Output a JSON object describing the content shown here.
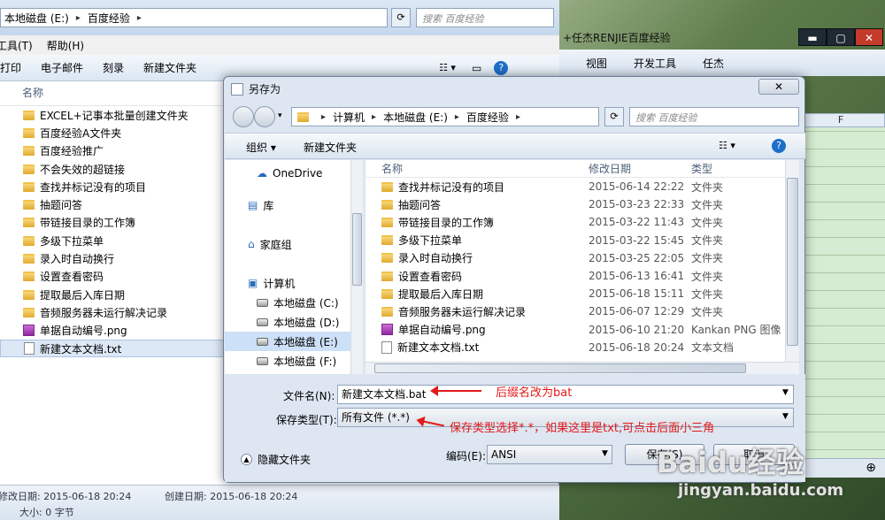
{
  "explorer": {
    "address": [
      "本地磁盘 (E:)",
      "百度经验"
    ],
    "search_placeholder": "搜索 百度经验",
    "menu": [
      "工具(T)",
      "帮助(H)"
    ],
    "toolbar": [
      "打印",
      "电子邮件",
      "刻录",
      "新建文件夹"
    ],
    "column_name": "名称",
    "items": [
      {
        "name": "EXCEL+记事本批量创建文件夹",
        "kind": "folder"
      },
      {
        "name": "百度经验A文件夹",
        "kind": "folder"
      },
      {
        "name": "百度经验推广",
        "kind": "folder"
      },
      {
        "name": "不会失效的超链接",
        "kind": "folder"
      },
      {
        "name": "查找并标记没有的项目",
        "kind": "folder"
      },
      {
        "name": "抽题问答",
        "kind": "folder"
      },
      {
        "name": "带链接目录的工作簿",
        "kind": "folder"
      },
      {
        "name": "多级下拉菜单",
        "kind": "folder"
      },
      {
        "name": "录入时自动换行",
        "kind": "folder"
      },
      {
        "name": "设置查看密码",
        "kind": "folder"
      },
      {
        "name": "提取最后入库日期",
        "kind": "folder"
      },
      {
        "name": "音频服务器未运行解决记录",
        "kind": "folder"
      },
      {
        "name": "单据自动编号.png",
        "kind": "png"
      },
      {
        "name": "新建文本文档.txt",
        "kind": "file",
        "selected": true
      }
    ],
    "status": {
      "modified_label": "修改日期:",
      "modified": "2015-06-18 20:24",
      "created_label": "创建日期:",
      "created": "2015-06-18 20:24",
      "size_label": "大小:",
      "size": "0 字节"
    }
  },
  "excel": {
    "title": "+任杰RENJIE百度经验",
    "ribbon": [
      "视图",
      "开发工具",
      "任杰"
    ],
    "column": "F"
  },
  "dialog": {
    "title": "另存为",
    "address": [
      "计算机",
      "本地磁盘 (E:)",
      "百度经验"
    ],
    "search_placeholder": "搜索 百度经验",
    "toolbar": {
      "organize": "组织 ▾",
      "new_folder": "新建文件夹"
    },
    "nav": [
      {
        "label": "OneDrive",
        "kind": "cloud"
      },
      {
        "label": "库",
        "kind": "lib"
      },
      {
        "label": "家庭组",
        "kind": "home"
      },
      {
        "label": "计算机",
        "kind": "pc"
      },
      {
        "label": "本地磁盘 (C:)",
        "kind": "drive"
      },
      {
        "label": "本地磁盘 (D:)",
        "kind": "drive"
      },
      {
        "label": "本地磁盘 (E:)",
        "kind": "drive",
        "selected": true
      },
      {
        "label": "本地磁盘 (F:)",
        "kind": "drive"
      }
    ],
    "columns": [
      "名称",
      "修改日期",
      "类型"
    ],
    "files": [
      {
        "name": "查找并标记没有的项目",
        "date": "2015-06-14 22:22",
        "type": "文件夹",
        "kind": "folder"
      },
      {
        "name": "抽题问答",
        "date": "2015-03-23 22:33",
        "type": "文件夹",
        "kind": "folder"
      },
      {
        "name": "带链接目录的工作簿",
        "date": "2015-03-22 11:43",
        "type": "文件夹",
        "kind": "folder"
      },
      {
        "name": "多级下拉菜单",
        "date": "2015-03-22 15:45",
        "type": "文件夹",
        "kind": "folder"
      },
      {
        "name": "录入时自动换行",
        "date": "2015-03-25 22:05",
        "type": "文件夹",
        "kind": "folder"
      },
      {
        "name": "设置查看密码",
        "date": "2015-06-13 16:41",
        "type": "文件夹",
        "kind": "folder"
      },
      {
        "name": "提取最后入库日期",
        "date": "2015-06-18 15:11",
        "type": "文件夹",
        "kind": "folder"
      },
      {
        "name": "音频服务器未运行解决记录",
        "date": "2015-06-07 12:29",
        "type": "文件夹",
        "kind": "folder"
      },
      {
        "name": "单据自动编号.png",
        "date": "2015-06-10 21:20",
        "type": "Kankan PNG 图像",
        "kind": "png"
      },
      {
        "name": "新建文本文档.txt",
        "date": "2015-06-18 20:24",
        "type": "文本文档",
        "kind": "file"
      }
    ],
    "filename_label": "文件名(N):",
    "filename_value": "新建文本文档.bat",
    "filetype_label": "保存类型(T):",
    "filetype_value": "所有文件 (*.*)",
    "hide_folders": "隐藏文件夹",
    "encoding_label": "编码(E):",
    "encoding_value": "ANSI",
    "save_button": "保存(S)",
    "cancel_button": "取消"
  },
  "annotations": {
    "rename_note": "后缀名改为bat",
    "type_note": "保存类型选择*.*，如果这里是txt,可点击后面小三角"
  },
  "watermark": {
    "logo": "Baidu经验",
    "url": "jingyan.baidu.com"
  },
  "colors": {
    "annotation": "#e31919",
    "selection": "#dde8f6"
  }
}
